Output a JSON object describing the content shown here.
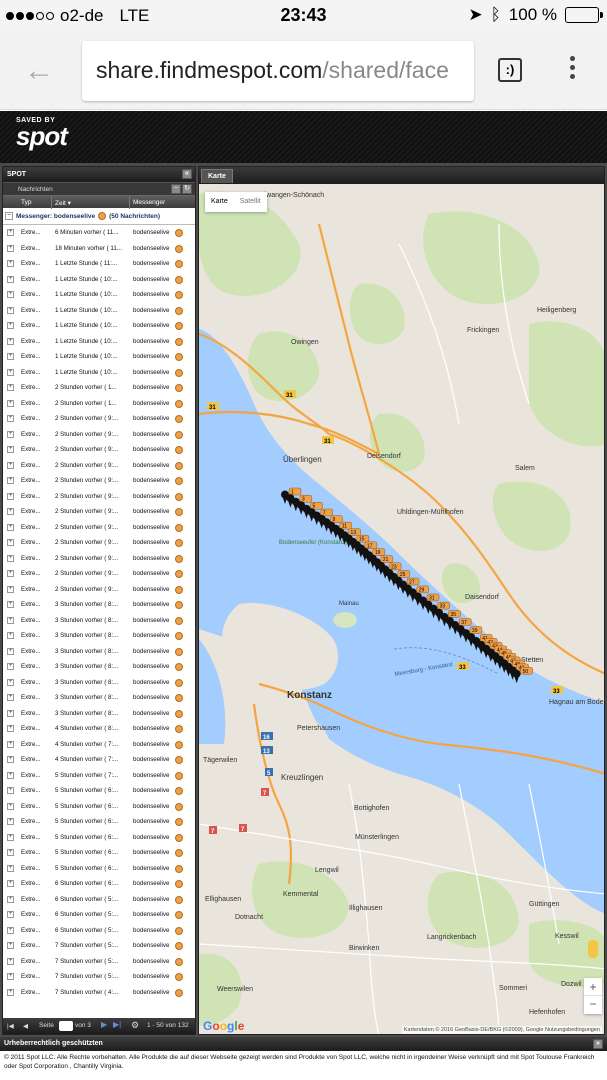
{
  "status_bar": {
    "carrier": "o2-de",
    "network": "LTE",
    "time": "23:43",
    "battery": "100 %"
  },
  "browser": {
    "url_host": "share.findmespot.com",
    "url_rest": "/shared/face",
    "tabs_icon": ":)"
  },
  "logo": {
    "saved_by": "SAVED BY",
    "brand": "spot"
  },
  "left_panel": {
    "title": "SPOT",
    "section": "Nachrichten",
    "columns": {
      "typ": "Typ",
      "zeit": "Zeit ▾",
      "messenger": "Messenger"
    },
    "group_label": "Messenger: bodenseelive",
    "group_count": "(50 Nachrichten)",
    "rows": [
      {
        "typ": "Extre...",
        "zeit": "6 Minuten vorher ( 11...",
        "msg": "bodenseelive"
      },
      {
        "typ": "Extre...",
        "zeit": "18 Minuten vorher ( 11...",
        "msg": "bodenseelive"
      },
      {
        "typ": "Extre...",
        "zeit": "1 Letzte Stunde ( 11:...",
        "msg": "bodenseelive"
      },
      {
        "typ": "Extre...",
        "zeit": "1 Letzte Stunde ( 10:...",
        "msg": "bodenseelive"
      },
      {
        "typ": "Extre...",
        "zeit": "1 Letzte Stunde ( 10:...",
        "msg": "bodenseelive"
      },
      {
        "typ": "Extre...",
        "zeit": "1 Letzte Stunde ( 10:...",
        "msg": "bodenseelive"
      },
      {
        "typ": "Extre...",
        "zeit": "1 Letzte Stunde ( 10:...",
        "msg": "bodenseelive"
      },
      {
        "typ": "Extre...",
        "zeit": "1 Letzte Stunde ( 10:...",
        "msg": "bodenseelive"
      },
      {
        "typ": "Extre...",
        "zeit": "1 Letzte Stunde ( 10:...",
        "msg": "bodenseelive"
      },
      {
        "typ": "Extre...",
        "zeit": "1 Letzte Stunde ( 10:...",
        "msg": "bodenseelive"
      },
      {
        "typ": "Extre...",
        "zeit": "2 Stunden vorher ( 1...",
        "msg": "bodenseelive"
      },
      {
        "typ": "Extre...",
        "zeit": "2 Stunden vorher ( 1...",
        "msg": "bodenseelive"
      },
      {
        "typ": "Extre...",
        "zeit": "2 Stunden vorher ( 9:...",
        "msg": "bodenseelive"
      },
      {
        "typ": "Extre...",
        "zeit": "2 Stunden vorher ( 9:...",
        "msg": "bodenseelive"
      },
      {
        "typ": "Extre...",
        "zeit": "2 Stunden vorher ( 9:...",
        "msg": "bodenseelive"
      },
      {
        "typ": "Extre...",
        "zeit": "2 Stunden vorher ( 9:...",
        "msg": "bodenseelive"
      },
      {
        "typ": "Extre...",
        "zeit": "2 Stunden vorher ( 9:...",
        "msg": "bodenseelive"
      },
      {
        "typ": "Extre...",
        "zeit": "2 Stunden vorher ( 9:...",
        "msg": "bodenseelive"
      },
      {
        "typ": "Extre...",
        "zeit": "2 Stunden vorher ( 9:...",
        "msg": "bodenseelive"
      },
      {
        "typ": "Extre...",
        "zeit": "2 Stunden vorher ( 9:...",
        "msg": "bodenseelive"
      },
      {
        "typ": "Extre...",
        "zeit": "2 Stunden vorher ( 9:...",
        "msg": "bodenseelive"
      },
      {
        "typ": "Extre...",
        "zeit": "2 Stunden vorher ( 9:...",
        "msg": "bodenseelive"
      },
      {
        "typ": "Extre...",
        "zeit": "2 Stunden vorher ( 9:...",
        "msg": "bodenseelive"
      },
      {
        "typ": "Extre...",
        "zeit": "2 Stunden vorher ( 9:...",
        "msg": "bodenseelive"
      },
      {
        "typ": "Extre...",
        "zeit": "3 Stunden vorher ( 8:...",
        "msg": "bodenseelive"
      },
      {
        "typ": "Extre...",
        "zeit": "3 Stunden vorher ( 8:...",
        "msg": "bodenseelive"
      },
      {
        "typ": "Extre...",
        "zeit": "3 Stunden vorher ( 8:...",
        "msg": "bodenseelive"
      },
      {
        "typ": "Extre...",
        "zeit": "3 Stunden vorher ( 8:...",
        "msg": "bodenseelive"
      },
      {
        "typ": "Extre...",
        "zeit": "3 Stunden vorher ( 8:...",
        "msg": "bodenseelive"
      },
      {
        "typ": "Extre...",
        "zeit": "3 Stunden vorher ( 8:...",
        "msg": "bodenseelive"
      },
      {
        "typ": "Extre...",
        "zeit": "3 Stunden vorher ( 8:...",
        "msg": "bodenseelive"
      },
      {
        "typ": "Extre...",
        "zeit": "3 Stunden vorher ( 8:...",
        "msg": "bodenseelive"
      },
      {
        "typ": "Extre...",
        "zeit": "4 Stunden vorher ( 8:...",
        "msg": "bodenseelive"
      },
      {
        "typ": "Extre...",
        "zeit": "4 Stunden vorher ( 7:...",
        "msg": "bodenseelive"
      },
      {
        "typ": "Extre...",
        "zeit": "4 Stunden vorher ( 7:...",
        "msg": "bodenseelive"
      },
      {
        "typ": "Extre...",
        "zeit": "5 Stunden vorher ( 7:...",
        "msg": "bodenseelive"
      },
      {
        "typ": "Extre...",
        "zeit": "5 Stunden vorher ( 6:...",
        "msg": "bodenseelive"
      },
      {
        "typ": "Extre...",
        "zeit": "5 Stunden vorher ( 6:...",
        "msg": "bodenseelive"
      },
      {
        "typ": "Extre...",
        "zeit": "5 Stunden vorher ( 6:...",
        "msg": "bodenseelive"
      },
      {
        "typ": "Extre...",
        "zeit": "5 Stunden vorher ( 6:...",
        "msg": "bodenseelive"
      },
      {
        "typ": "Extre...",
        "zeit": "5 Stunden vorher ( 6:...",
        "msg": "bodenseelive"
      },
      {
        "typ": "Extre...",
        "zeit": "5 Stunden vorher ( 6:...",
        "msg": "bodenseelive"
      },
      {
        "typ": "Extre...",
        "zeit": "6 Stunden vorher ( 6:...",
        "msg": "bodenseelive"
      },
      {
        "typ": "Extre...",
        "zeit": "6 Stunden vorher ( 5:...",
        "msg": "bodenseelive"
      },
      {
        "typ": "Extre...",
        "zeit": "6 Stunden vorher ( 5:...",
        "msg": "bodenseelive"
      },
      {
        "typ": "Extre...",
        "zeit": "6 Stunden vorher ( 5:...",
        "msg": "bodenseelive"
      },
      {
        "typ": "Extre...",
        "zeit": "7 Stunden vorher ( 5:...",
        "msg": "bodenseelive"
      },
      {
        "typ": "Extre...",
        "zeit": "7 Stunden vorher ( 5:...",
        "msg": "bodenseelive"
      },
      {
        "typ": "Extre...",
        "zeit": "7 Stunden vorher ( 5:...",
        "msg": "bodenseelive"
      },
      {
        "typ": "Extre...",
        "zeit": "7 Stunden vorher ( 4:...",
        "msg": "bodenseelive"
      }
    ],
    "footer": {
      "page_label": "Seite",
      "page_value": "1",
      "of_label": "von 3",
      "range": "1 - 50 von 132"
    }
  },
  "map_panel": {
    "tab": "Karte",
    "maptype": {
      "map": "Karte",
      "satellite": "Satellit"
    },
    "google": "Google",
    "attribution": "Kartendaten © 2016 GeoBasis-DE/BKG (©2009), Google   Nutzungsbedingungen",
    "places": [
      "Herdwangen-Schönach",
      "Heiligenberg",
      "Owingen",
      "Frickingen",
      "Überlingen",
      "Deisendorf",
      "Salem",
      "Uhldingen-Mühlhofen",
      "Daisendorf",
      "Bodenseeufer (Konstanz)",
      "Mainau",
      "Konstanz",
      "Petershausen",
      "Stetten",
      "Hagnau am Bodensee",
      "Tägerwilen",
      "Kreuzlingen",
      "Bottighofen",
      "Münsterlingen",
      "Lengwil",
      "Ellighausen",
      "Kemmental",
      "Illighausen",
      "Güttingen",
      "Dotnacht",
      "Langrickenbach",
      "Kesswil",
      "Birwinken",
      "Weerswilen",
      "Sommeri",
      "Hefenhofen",
      "Dozwil",
      "Meersburg - Konstanz"
    ],
    "markers": [
      "1",
      "2",
      "3",
      "4",
      "5",
      "6",
      "7",
      "8",
      "9",
      "10",
      "11",
      "12",
      "13",
      "14",
      "15",
      "16",
      "17",
      "18",
      "19",
      "20",
      "21",
      "22",
      "23",
      "24",
      "25",
      "26",
      "27",
      "28",
      "29",
      "30",
      "31",
      "32",
      "33",
      "34",
      "35",
      "36",
      "37",
      "38",
      "39",
      "40",
      "41",
      "42",
      "43",
      "44",
      "45",
      "46",
      "47",
      "48",
      "49",
      "50"
    ],
    "road_numbers": [
      "31",
      "31",
      "31",
      "33",
      "33",
      "16",
      "13",
      "7",
      "7",
      "7",
      "5"
    ]
  },
  "footer": {
    "bar": "Urheberrechtlich geschützten",
    "text": "© 2011 Spot LLC. Alle Rechte vorbehalten. Alle Produkte die auf dieser Webseite gezeigt werden sind Produkte von Spot LLC, welche nicht in irgendeiner Weise verknüpft sind mit Spot Toulouse Frankreich oder Spot Corporation , Chantilly Virginia."
  },
  "colors": {
    "water": "#a3ccff",
    "land": "#e9e5dc",
    "green": "#cfe3b4",
    "road_major": "#f4a541",
    "marker_orange": "#f0a04b"
  }
}
